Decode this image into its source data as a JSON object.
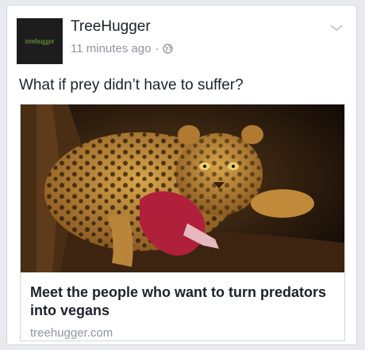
{
  "post": {
    "page_name": "TreeHugger",
    "avatar_text": "treehugger",
    "time_ago": "11 minutes ago",
    "separator": "·",
    "privacy_icon": "globe-icon",
    "menu_icon": "chevron-down-icon",
    "status_text": "What if prey didn’t have to suffer?"
  },
  "link": {
    "image": "leopard-eating-prey-photo",
    "title": "Meet the people who want to turn predators into vegans",
    "domain": "treehugger.com"
  },
  "colors": {
    "background": "#e9eaed",
    "text_primary": "#1d2129",
    "text_secondary": "#90949c",
    "avatar_bg": "#1d1d1d",
    "avatar_text": "#6fae3a"
  }
}
